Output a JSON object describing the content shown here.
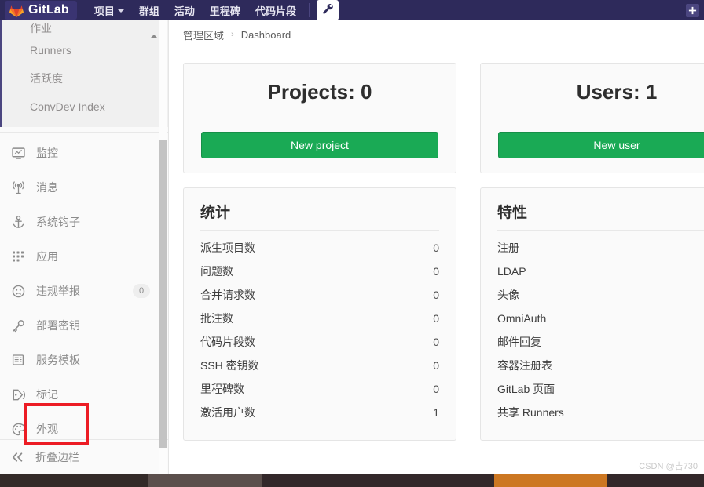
{
  "navbar": {
    "brand": "GitLab",
    "brand_logo_icon": "gitlab-fox-logo",
    "links": [
      {
        "label": "项目",
        "has_caret": true
      },
      {
        "label": "群组",
        "has_caret": false
      },
      {
        "label": "活动",
        "has_caret": false
      },
      {
        "label": "里程碑",
        "has_caret": false
      },
      {
        "label": "代码片段",
        "has_caret": false
      }
    ],
    "admin_icon": "wrench-icon",
    "new_icon": "plus-icon"
  },
  "sidebar": {
    "subnav_items": [
      {
        "label": "作业"
      },
      {
        "label": "Runners"
      },
      {
        "label": "活跃度"
      },
      {
        "label": "ConvDev Index"
      }
    ],
    "subnav_collapse_icon": "caret-up-icon",
    "items": [
      {
        "label": "监控",
        "icon": "monitor-icon",
        "badge": null,
        "highlighted": false
      },
      {
        "label": "消息",
        "icon": "broadcast-icon",
        "badge": null,
        "highlighted": false
      },
      {
        "label": "系统钩子",
        "icon": "anchor-icon",
        "badge": null,
        "highlighted": false
      },
      {
        "label": "应用",
        "icon": "apps-grid-icon",
        "badge": null,
        "highlighted": false
      },
      {
        "label": "违规举报",
        "icon": "abuse-face-icon",
        "badge": "0",
        "highlighted": false
      },
      {
        "label": "部署密钥",
        "icon": "key-icon",
        "badge": null,
        "highlighted": false
      },
      {
        "label": "服务模板",
        "icon": "template-icon",
        "badge": null,
        "highlighted": false
      },
      {
        "label": "标记",
        "icon": "tag-icon",
        "badge": null,
        "highlighted": false
      },
      {
        "label": "外观",
        "icon": "palette-icon",
        "badge": null,
        "highlighted": true
      }
    ],
    "collapse": {
      "label": "折叠边栏",
      "icon": "double-chevron-left-icon"
    },
    "highlight_color": "#ec1c24"
  },
  "breadcrumb": {
    "root": "管理区域",
    "separator": "›",
    "current": "Dashboard"
  },
  "cards": {
    "projects": {
      "title": "Projects: 0",
      "button": "New project",
      "button_color": "#1aaa55"
    },
    "users": {
      "title": "Users: 1",
      "button": "New user",
      "button_color": "#1aaa55"
    },
    "statistics": {
      "title": "统计",
      "rows": [
        {
          "label": "派生项目数",
          "value": "0"
        },
        {
          "label": "问题数",
          "value": "0"
        },
        {
          "label": "合并请求数",
          "value": "0"
        },
        {
          "label": "批注数",
          "value": "0"
        },
        {
          "label": "代码片段数",
          "value": "0"
        },
        {
          "label": "SSH 密钥数",
          "value": "0"
        },
        {
          "label": "里程碑数",
          "value": "0"
        },
        {
          "label": "激活用户数",
          "value": "1"
        }
      ]
    },
    "features": {
      "title": "特性",
      "rows": [
        {
          "label": "注册"
        },
        {
          "label": "LDAP"
        },
        {
          "label": "头像"
        },
        {
          "label": "OmniAuth"
        },
        {
          "label": "邮件回复"
        },
        {
          "label": "容器注册表"
        },
        {
          "label": "GitLab 页面"
        },
        {
          "label": "共享 Runners"
        }
      ]
    }
  },
  "watermark": "CSDN @吉730"
}
